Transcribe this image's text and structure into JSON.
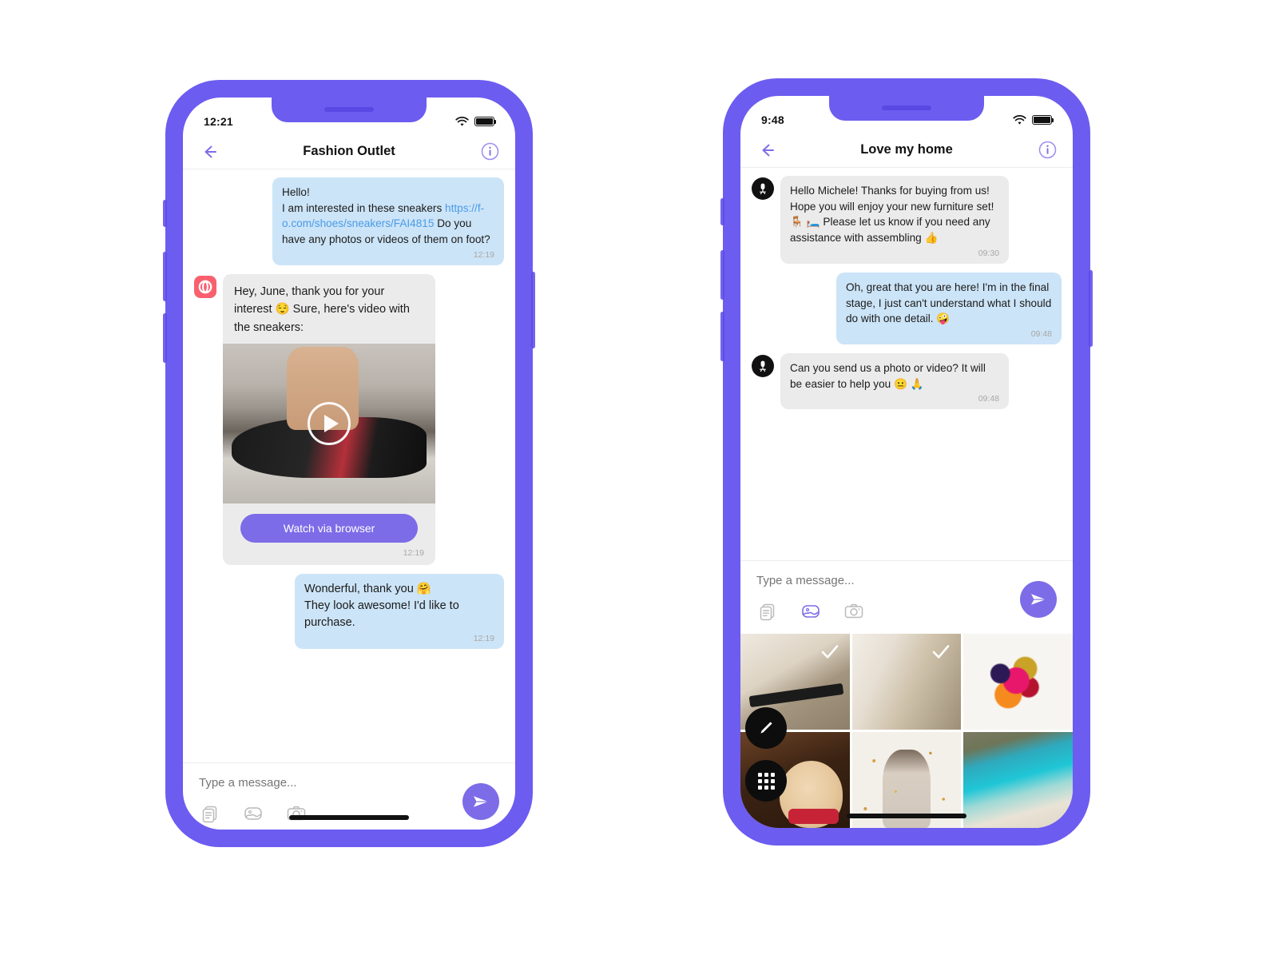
{
  "phone1": {
    "status": {
      "time": "12:21",
      "wifi_icon": "wifi-icon",
      "battery_icon": "battery-full-icon"
    },
    "nav": {
      "back_icon": "back-arrow-icon",
      "title": "Fashion Outlet",
      "info_icon": "info-circle-icon"
    },
    "messages": [
      {
        "direction": "out",
        "line1": "Hello!",
        "line2": "I am interested in these sneakers ",
        "link": "https://f-o.com/shoes/sneakers/FAI4815",
        "line3": " Do you have any photos or videos of them on foot?",
        "time": "12:19"
      },
      {
        "direction": "in",
        "avatar": "opera-logo-avatar",
        "text": "Hey, June, thank you for your interest 😌 Sure, here's video with the sneakers:",
        "media": {
          "type": "video",
          "play_icon": "play-icon",
          "thumbnail": "sneakers-on-foot-thumbnail"
        },
        "button": "Watch via browser",
        "time": "12:19"
      },
      {
        "direction": "out",
        "text": "Wonderful, thank you 🤗\nThey look awesome! I'd like to purchase.",
        "time": "12:19"
      }
    ],
    "composer": {
      "placeholder": "Type a message...",
      "value": "",
      "icons": [
        "templates-icon",
        "gallery-icon",
        "camera-icon"
      ],
      "send_icon": "send-icon"
    }
  },
  "phone2": {
    "status": {
      "time": "9:48",
      "wifi_icon": "wifi-icon",
      "battery_icon": "battery-full-icon"
    },
    "nav": {
      "back_icon": "back-arrow-icon",
      "title": "Love my home",
      "info_icon": "info-circle-icon"
    },
    "messages": [
      {
        "direction": "in",
        "avatar": "chair-lamp-avatar",
        "text": "Hello Michele! Thanks for buying from us! Hope you will enjoy your new furniture set! 🪑 🛏️ Please let us know if you need any assistance with assembling 👍",
        "time": "09:30"
      },
      {
        "direction": "out",
        "text": "Oh, great that you are here! I'm in the final stage, I just can't understand what I should do with one detail. 🤪",
        "time": "09:48"
      },
      {
        "direction": "in",
        "avatar": "chair-lamp-avatar",
        "text": "Can you send us a photo or video? It will be easier to help you 😐 🙏",
        "time": "09:48"
      }
    ],
    "composer": {
      "placeholder": "Type a message...",
      "value": "",
      "icons": [
        "templates-icon",
        "gallery-icon",
        "camera-icon"
      ],
      "active_icon": "gallery-icon",
      "send_icon": "send-icon"
    },
    "gallery": {
      "thumbnails": [
        {
          "name": "ceiling-photo",
          "selected": true
        },
        {
          "name": "wall-corner-photo",
          "selected": true
        },
        {
          "name": "paint-splash-photo",
          "selected": false
        },
        {
          "name": "dog-photo",
          "selected": false
        },
        {
          "name": "confetti-woman-photo",
          "selected": false
        },
        {
          "name": "beach-photo",
          "selected": false
        }
      ],
      "edit_button_icon": "pencil-icon",
      "grid_button_icon": "grid-icon"
    }
  },
  "colors": {
    "frame": "#6C5CF0",
    "accent": "#7C6CE8",
    "bubble_in": "#EBEBEB",
    "bubble_out": "#CCE4F7",
    "link": "#4A9BE8",
    "avatar_opera": "#F8606E"
  }
}
